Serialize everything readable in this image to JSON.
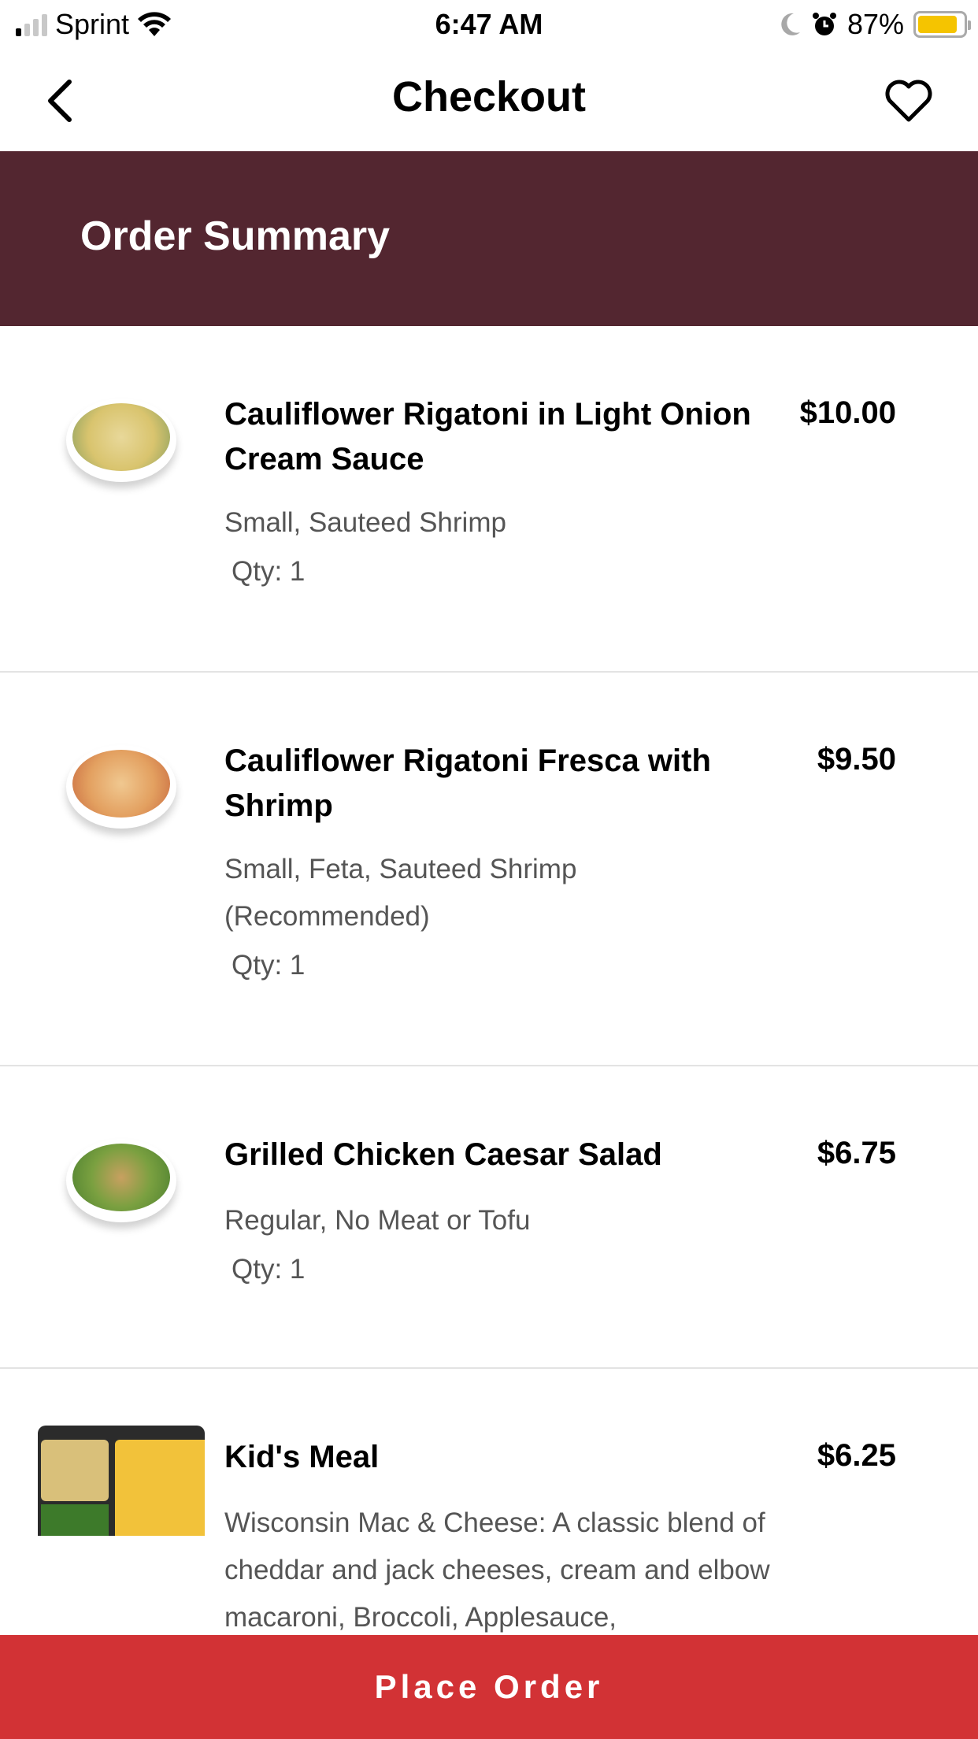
{
  "status_bar": {
    "carrier": "Sprint",
    "time": "6:47 AM",
    "battery_percent": "87%",
    "battery_level": 0.87,
    "signal_bars_on": 1,
    "signal_bars_total": 4,
    "icons": [
      "signal-icon",
      "wifi-icon",
      "moon-icon",
      "alarm-icon",
      "battery-icon"
    ]
  },
  "nav": {
    "title": "Checkout",
    "back_icon": "chevron-left-icon",
    "favorite_icon": "heart-icon"
  },
  "summary": {
    "title": "Order Summary",
    "band_color": "#532630"
  },
  "items": [
    {
      "name": "Cauliflower Rigatoni in Light Onion Cream Sauce",
      "price": "$10.00",
      "options": "Small, Sauteed Shrimp",
      "qty": "Qty: 1"
    },
    {
      "name": "Cauliflower Rigatoni Fresca with Shrimp",
      "price": "$9.50",
      "options": "Small, Feta, Sauteed Shrimp (Recommended)",
      "qty": "Qty: 1"
    },
    {
      "name": "Grilled Chicken Caesar Salad",
      "price": "$6.75",
      "options": "Regular, No Meat or Tofu",
      "qty": "Qty: 1"
    },
    {
      "name": "Kid's Meal",
      "price": "$6.25",
      "options": "Wisconsin Mac & Cheese: A classic blend of cheddar and jack cheeses, cream and elbow macaroni, Broccoli, Applesauce,"
    }
  ],
  "place_order": {
    "label": "Place Order",
    "color": "#d23235"
  }
}
